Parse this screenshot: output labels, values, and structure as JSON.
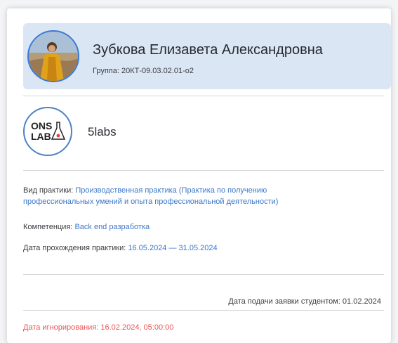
{
  "student": {
    "name": "Зубкова Елизавета Александровна",
    "group": "Группа: 20КТ-09.03.02.01-о2"
  },
  "company": {
    "name": "5labs",
    "logo_text_line1": "ONS",
    "logo_text_line2": "LAB"
  },
  "practice": {
    "type_label": "Вид практики:",
    "type_value_line1": "Производственная практика (Практика по получению",
    "type_value_line2": "профессиональных умений и опыта профессиональной деятельности)",
    "competence_label": "Компетенция:",
    "competence_value": "Back end разработка",
    "dates_label": "Дата прохождения практики:",
    "dates_value": "16.05.2024 — 31.05.2024"
  },
  "application": {
    "submit_date": "Дата подачи заявки студентом: 01.02.2024",
    "ignore_date": "Дата игнорирования: 16.02.2024, 05:00:00"
  },
  "colors": {
    "accent": "#3a78c9",
    "header_bg": "#dbe6f5",
    "warning": "#ea5555"
  }
}
